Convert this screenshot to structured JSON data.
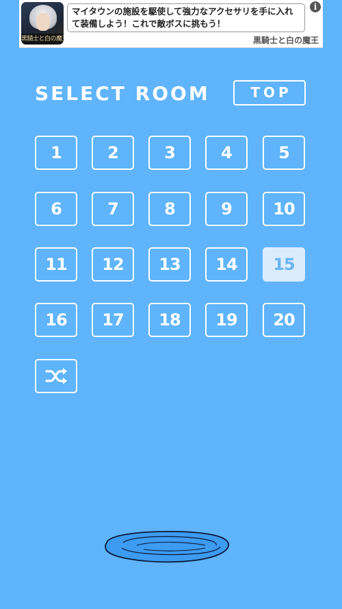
{
  "ad": {
    "thumb_caption": "黒騎士と白の魔王",
    "text": "マイタウンの施設を駆使して強力なアクセサリを手に入れて装備しよう！これで敵ボスに挑もう！",
    "title": "黒騎士と白の魔王",
    "info_glyph": "i"
  },
  "header": {
    "title": "SELECT ROOM",
    "top_button": "TOP"
  },
  "rooms": [
    "1",
    "2",
    "3",
    "4",
    "5",
    "6",
    "7",
    "8",
    "9",
    "10",
    "11",
    "12",
    "13",
    "14",
    "15",
    "16",
    "17",
    "18",
    "19",
    "20"
  ],
  "current_room": "15",
  "icons": {
    "shuffle": "shuffle-icon",
    "puddle": "puddle-illustration"
  },
  "colors": {
    "background": "#5fb4fb",
    "current_room_bg": "#dcecfd",
    "current_room_text": "#69b5f6"
  }
}
